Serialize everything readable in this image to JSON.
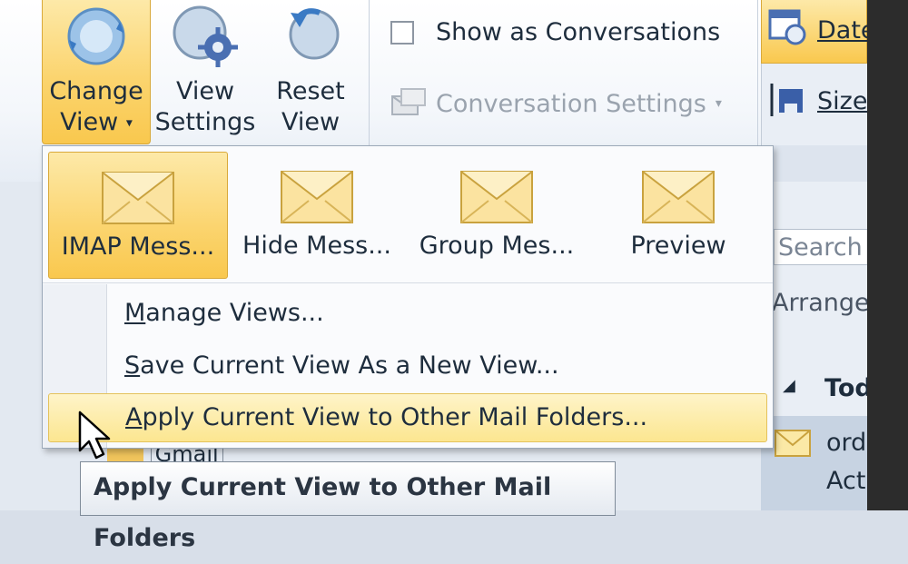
{
  "ribbon": {
    "change_view": {
      "line1": "Change",
      "line2": "View",
      "caret": "▾"
    },
    "view_settings": {
      "line1": "View",
      "line2": "Settings"
    },
    "reset_view": {
      "line1": "Reset",
      "line2": "View"
    },
    "show_as_conversations": "Show as Conversations",
    "conversation_settings": "Conversation Settings",
    "conversation_settings_caret": "▾"
  },
  "right_panel": {
    "date_label": "Date",
    "size_label": "Size",
    "search_placeholder": "Search I",
    "arrange_label": "Arrange",
    "today_group": "Tod",
    "mail_line1": "ord",
    "mail_line2": "Act"
  },
  "dropdown": {
    "gallery": [
      {
        "label": "IMAP Mess..."
      },
      {
        "label": "Hide Mess..."
      },
      {
        "label": "Group Mes..."
      },
      {
        "label": "Preview"
      }
    ],
    "manage_views": {
      "ul": "M",
      "rest": "anage Views..."
    },
    "save_view": {
      "ul": "S",
      "rest": "ave Current View As a New View..."
    },
    "apply_view": {
      "ul": "A",
      "rest": "pply Current View to Other Mail Folders..."
    }
  },
  "folder_pane": {
    "partial_item": "Gmail"
  },
  "tooltip": "Apply Current View to Other Mail Folders",
  "colors": {
    "highlight": "#f9c84e",
    "hover": "#fce690",
    "ribbon_bg": "#f4f7fb"
  }
}
